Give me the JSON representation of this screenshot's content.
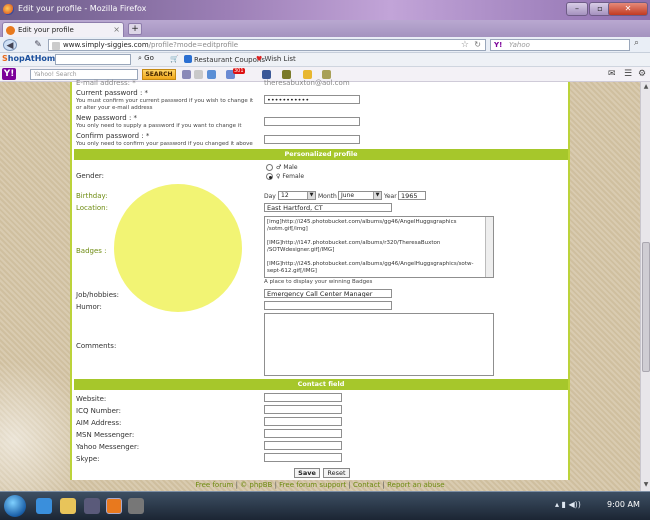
{
  "window": {
    "title": "Edit your profile - Mozilla Firefox"
  },
  "tab": {
    "label": "Edit your profile",
    "new_tab": "+"
  },
  "nav": {
    "url_domain": "www.simply-siggies.com",
    "url_path": "/profile?mode=editprofile",
    "search_placeholder": "Yahoo",
    "search_logo": "Y!"
  },
  "shop_toolbar": {
    "logo_a": "hop",
    "logo_b": "AtHome",
    "logo_prefix": "S",
    "go": "Go",
    "restaurant": "Restaurant Coupons",
    "wishlist": "Wish List"
  },
  "yahoo_toolbar": {
    "logo": "Y!",
    "search_placeholder": "Yahoo! Search",
    "search_button": "SEARCH",
    "mail_badge": "301"
  },
  "form": {
    "email_cut": "E-mail address: *",
    "email_value": "theresabuxton@aol.com",
    "current_pw_label": "Current password : *",
    "current_pw_help1": "You must confirm your current password if you wish to change it",
    "current_pw_help2": "or alter your e-mail address",
    "current_pw_value": "•••••••••••",
    "new_pw_label": "New password : *",
    "new_pw_help": "You only need to supply a password if you want to change it",
    "confirm_pw_label": "Confirm password : *",
    "confirm_pw_help": "You only need to confirm your password if you changed it above",
    "section_personalized": "Personalized profile",
    "gender_label": "Gender:",
    "gender_male": "Male",
    "gender_female": "Female",
    "birthday_label": "Birthday:",
    "day_label": "Day",
    "day_value": "12",
    "month_label": "Month",
    "month_value": "June",
    "year_label": "Year",
    "year_value": "1965",
    "location_label": "Location:",
    "location_value": "East Hartford, CT",
    "badges_label": "Badges :",
    "badges_line1": "[img]http://i245.photobucket.com/albums/gg46/AngelHuggsgraphics",
    "badges_line2": "/sotm.gif[/img]",
    "badges_line3": "[IMG]http://i147.photobucket.com/albums/r320/TheresaBuxton",
    "badges_line4": "/SOTWdesigner.gif[/IMG]",
    "badges_line5": "[IMG]http://i245.photobucket.com/albums/gg46/AngelHuggsgraphics/sotw-",
    "badges_line6": "sept-612.gif[/IMG]",
    "badges_help": "A place to display your winning Badges",
    "job_label": "Job/hobbies:",
    "job_value": "Emergency Call Center Manager",
    "humor_label": "Humor:",
    "comments_label": "Comments:",
    "section_contact": "Contact field",
    "website_label": "Website:",
    "icq_label": "ICQ Number:",
    "aim_label": "AIM Address:",
    "msn_label": "MSN Messenger:",
    "yahoo_label": "Yahoo Messenger:",
    "skype_label": "Skype:",
    "save_button": "Save",
    "reset_button": "Reset"
  },
  "footer": {
    "free_forum": "Free forum",
    "phpbb": "© phpBB",
    "support": "Free forum support",
    "contact": "Contact",
    "abuse": "Report an abuse",
    "sep": "|"
  },
  "taskbar": {
    "time": "9:00 AM"
  },
  "colors": {
    "accent_green": "#a6c72b",
    "highlight_yellow": "#eef046"
  }
}
